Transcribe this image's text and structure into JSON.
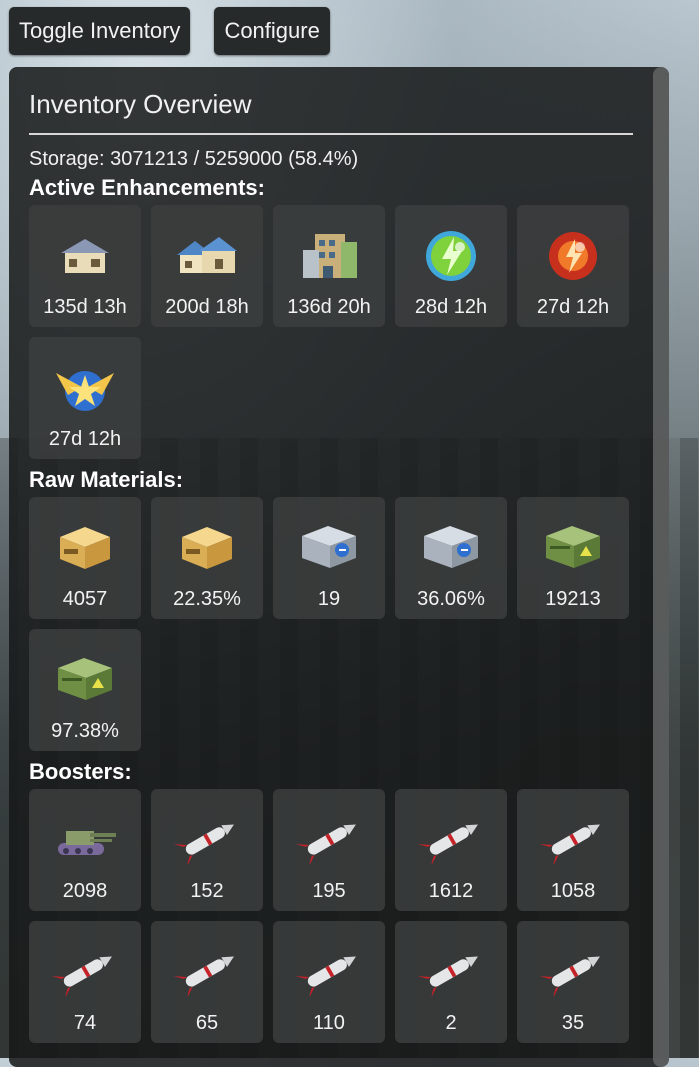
{
  "toolbar": {
    "toggle_label": "Toggle Inventory",
    "configure_label": "Configure"
  },
  "panel": {
    "title": "Inventory Overview",
    "storage_text": "Storage: 3071213 / 5259000 (58.4%)"
  },
  "sections": {
    "enhancements": {
      "heading": "Active Enhancements:",
      "items": [
        {
          "icon": "house-small-icon",
          "label": "135d 13h"
        },
        {
          "icon": "house-large-icon",
          "label": "200d 18h"
        },
        {
          "icon": "office-building-icon",
          "label": "136d 20h"
        },
        {
          "icon": "green-energy-orb-icon",
          "label": "28d 12h"
        },
        {
          "icon": "red-fire-orb-icon",
          "label": "27d 12h"
        },
        {
          "icon": "golden-wings-orb-icon",
          "label": "27d 12h"
        }
      ]
    },
    "materials": {
      "heading": "Raw Materials:",
      "items": [
        {
          "icon": "food-crate-icon",
          "label": "4057"
        },
        {
          "icon": "food-crate-icon",
          "label": "22.35%"
        },
        {
          "icon": "metal-case-icon",
          "label": "19"
        },
        {
          "icon": "metal-case-icon",
          "label": "36.06%"
        },
        {
          "icon": "military-crate-icon",
          "label": "19213"
        },
        {
          "icon": "military-crate-icon",
          "label": "97.38%"
        }
      ]
    },
    "boosters": {
      "heading": "Boosters:",
      "items": [
        {
          "icon": "tank-icon",
          "label": "2098"
        },
        {
          "icon": "missile-icon",
          "label": "152"
        },
        {
          "icon": "missile-icon",
          "label": "195"
        },
        {
          "icon": "missile-icon",
          "label": "1612"
        },
        {
          "icon": "missile-icon",
          "label": "1058"
        },
        {
          "icon": "missile-icon",
          "label": "74"
        },
        {
          "icon": "missile-icon",
          "label": "65"
        },
        {
          "icon": "missile-icon",
          "label": "110"
        },
        {
          "icon": "missile-icon",
          "label": "2"
        },
        {
          "icon": "missile-icon",
          "label": "35"
        }
      ]
    }
  }
}
